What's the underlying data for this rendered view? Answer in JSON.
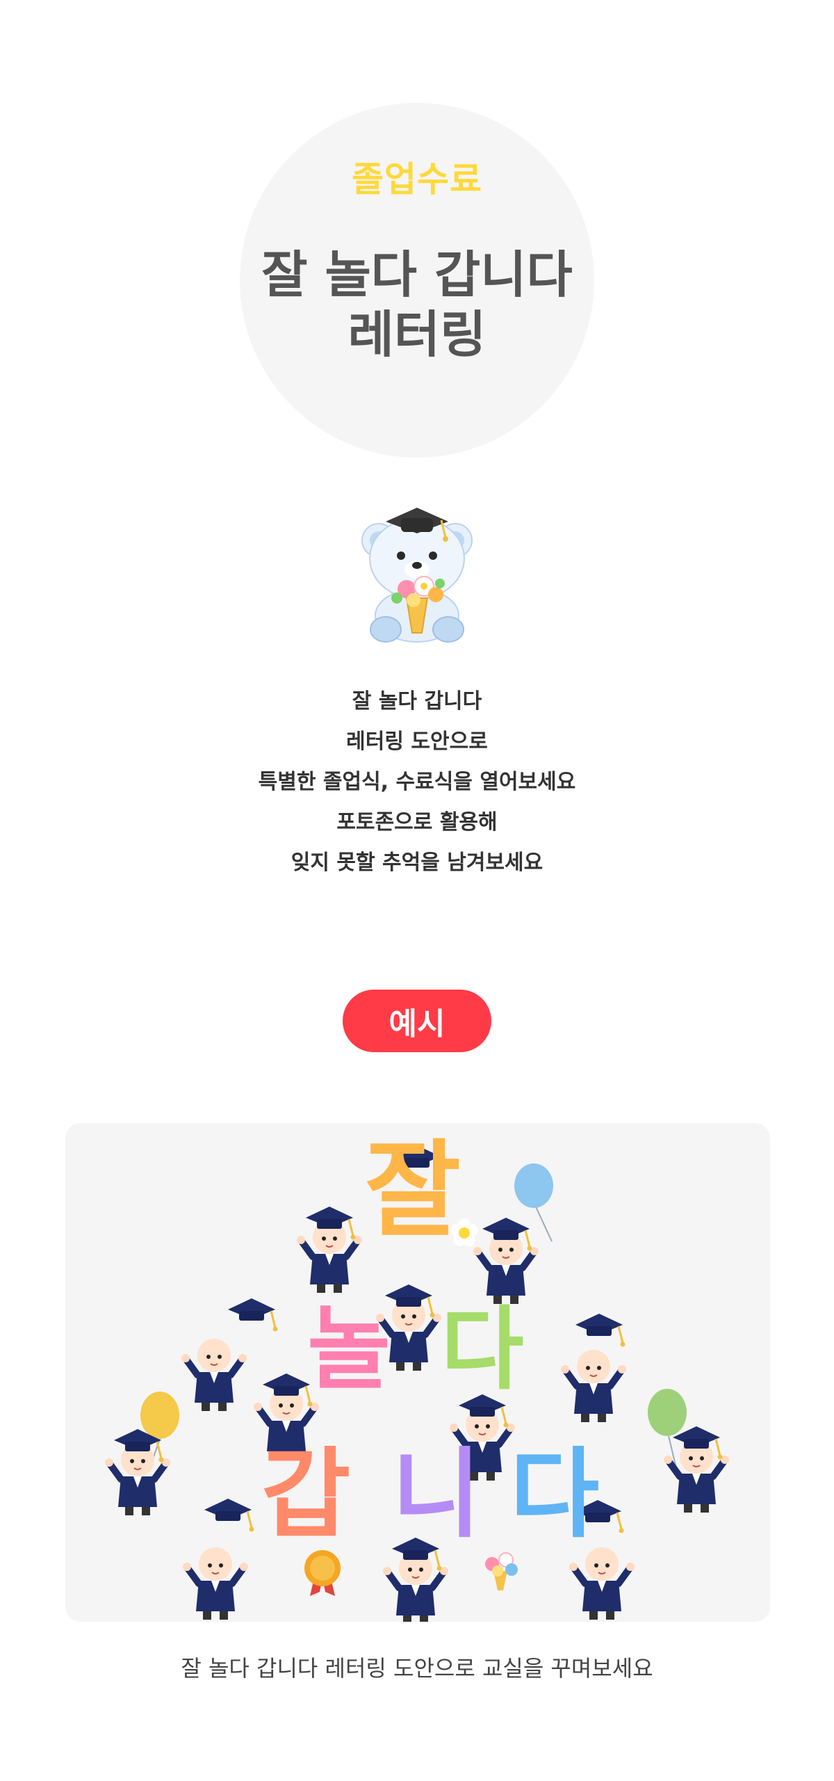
{
  "hero": {
    "eyebrow": "졸업수료",
    "title_line1": "잘 놀다 갑니다",
    "title_line2": "레터링"
  },
  "intro": {
    "lines": [
      "잘 놀다 갑니다",
      "레터링 도안으로",
      "특별한 졸업식, 수료식을 열어보세요",
      "포토존으로 활용해",
      "잊지 못할 추억을 남겨보세요"
    ]
  },
  "example": {
    "badge_label": "예시",
    "lettering": {
      "row1": [
        "잘"
      ],
      "row2": [
        "놀",
        "다"
      ],
      "row3": [
        "갑",
        "니",
        "다"
      ]
    },
    "letter_colors": {
      "잘": "#ffb648",
      "놀": "#ff7fb0",
      "다_row2": "#a6dc6a",
      "갑": "#ff8a6a",
      "니": "#b58cf5",
      "다_row3": "#5fb4f5"
    },
    "caption": "잘 놀다 갑니다 레터링 도안으로 교실을 꾸며보세요"
  },
  "colors": {
    "accent_red": "#ff3b47",
    "eyebrow_yellow": "#ffd93a",
    "title_gray": "#555555",
    "panel_bg": "#f5f5f5",
    "gown_navy": "#1f2d6b"
  },
  "icons": {
    "mascot": "graduation-bear-icon",
    "cap": "graduation-cap-icon",
    "balloon": "balloon-icon",
    "flower": "daisy-icon",
    "medal": "medal-icon",
    "bouquet": "bouquet-icon"
  }
}
